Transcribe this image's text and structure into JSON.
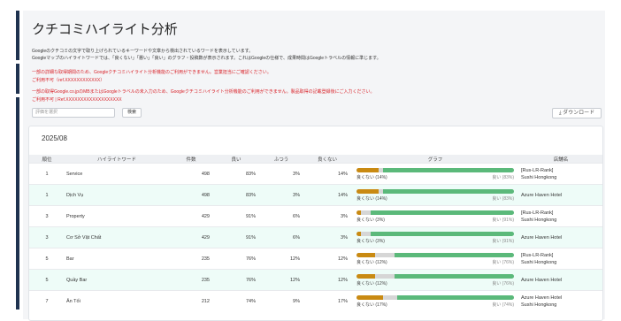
{
  "page": {
    "title": "クチコミハイライト分析",
    "desc1": "Googleのクチコミの文字で取り上げられているキーワードや文章から検出されているワードを表示しています。",
    "desc2": "Googleマップのハイライトワードでは、「良くない」「悪い」「良い」のグラフ・投稿数が表示されます。これはGoogleの仕様で、成果時間はGoogleトラベルの情報に準じます。",
    "red1": "一部の詳細な取得期間のため、Googleクチコミハイライト分析機能のご利用ができません。営業担当にご確認ください。",
    "red2": "ご利用不可（ref.XXXXXXXXXXXX）",
    "red3": "一部の取得Google.co.jpのMBまたはGoogleトラベルの未入力のため、Googleクチコミハイライト分析機能のご利用ができません。製品取得の記載登録後にご入力ください。",
    "red4": "ご利用不可 | Ref.XXXXXXXXXXXXXXXXXXX"
  },
  "controls": {
    "search_placeholder": "評価を選択",
    "search_button": "検索",
    "download_button": "⤓ ダウンロード"
  },
  "section": {
    "period": "2025/08"
  },
  "table": {
    "headers": [
      "順位",
      "ハイライトワード",
      "件数",
      "良い",
      "ふつう",
      "良くない",
      "グラフ",
      "店舗名"
    ],
    "rows": [
      {
        "rank": "1",
        "word": "Service",
        "count": "498",
        "good": "83%",
        "neutral": "3%",
        "bad": "14%",
        "neg_label": "良くない (14%)",
        "pos_label": "良い (83%)",
        "neg": 14,
        "neu": 3,
        "pos": 83,
        "hotel1": "[Rus-LR-Rank]",
        "hotel2": "Sushi Hongkong",
        "hl": false
      },
      {
        "rank": "1",
        "word": "Dịch Vụ",
        "count": "498",
        "good": "83%",
        "neutral": "3%",
        "bad": "14%",
        "neg_label": "良くない (14%)",
        "pos_label": "良い (83%)",
        "neg": 14,
        "neu": 3,
        "pos": 83,
        "hotel1": "Azure Haven Hotel",
        "hotel2": "",
        "hl": true
      },
      {
        "rank": "3",
        "word": "Property",
        "count": "429",
        "good": "91%",
        "neutral": "6%",
        "bad": "3%",
        "neg_label": "良くない (3%)",
        "pos_label": "良い (91%)",
        "neg": 3,
        "neu": 6,
        "pos": 91,
        "hotel1": "[Rus-LR-Rank]",
        "hotel2": "Sushi Hongkong",
        "hl": false
      },
      {
        "rank": "3",
        "word": "Cơ Sở Vật Chất",
        "count": "429",
        "good": "91%",
        "neutral": "6%",
        "bad": "3%",
        "neg_label": "良くない (3%)",
        "pos_label": "良い (91%)",
        "neg": 3,
        "neu": 6,
        "pos": 91,
        "hotel1": "Azure Haven Hotel",
        "hotel2": "",
        "hl": true
      },
      {
        "rank": "5",
        "word": "Bar",
        "count": "235",
        "good": "76%",
        "neutral": "12%",
        "bad": "12%",
        "neg_label": "良くない (12%)",
        "pos_label": "良い (76%)",
        "neg": 12,
        "neu": 12,
        "pos": 76,
        "hotel1": "[Rus-LR-Rank]",
        "hotel2": "Sushi Hongkong",
        "hl": false
      },
      {
        "rank": "5",
        "word": "Quầy Bar",
        "count": "235",
        "good": "76%",
        "neutral": "12%",
        "bad": "12%",
        "neg_label": "良くない (12%)",
        "pos_label": "良い (76%)",
        "neg": 12,
        "neu": 12,
        "pos": 76,
        "hotel1": "Azure Haven Hotel",
        "hotel2": "",
        "hl": true
      },
      {
        "rank": "7",
        "word": "Ăn Tối",
        "count": "212",
        "good": "74%",
        "neutral": "9%",
        "bad": "17%",
        "neg_label": "良くない (17%)",
        "pos_label": "良い (74%)",
        "neg": 17,
        "neu": 9,
        "pos": 74,
        "hotel1": "Azure Haven Hotel",
        "hotel2": "Sushi Hongkong",
        "hl": false
      }
    ]
  },
  "colors": {
    "negative": "#c98a12",
    "neutral": "#d6d6d6",
    "positive": "#5bb97a",
    "highlight": "#eefcf8"
  }
}
